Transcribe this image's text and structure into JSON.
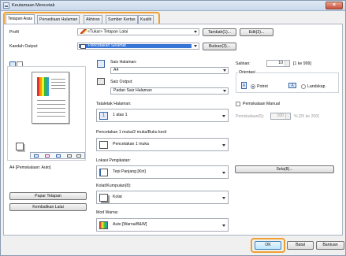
{
  "window": {
    "title": "Keutamaan Mencetak",
    "close_label": "×"
  },
  "tabs": [
    {
      "label": "Tetapan Asas"
    },
    {
      "label": "Persediaan Halaman"
    },
    {
      "label": "Akhiran"
    },
    {
      "label": "Sumber Kertas"
    },
    {
      "label": "Kualiti"
    }
  ],
  "profile": {
    "label": "Profil",
    "value": "<Tukar> Tetapan Lalai",
    "add_button": "Tambah(1)...",
    "edit_button": "Edit(2)..."
  },
  "output": {
    "label": "Kaedah Output:",
    "value": "Pencetakan Selamat",
    "details_button": "Butiran(3)..."
  },
  "preview": {
    "caption": "A4 [Pemskalaan: Auto]",
    "page_layout_button": "Papar Tetapan",
    "restore_defaults_button": "Kembalikan Lalai"
  },
  "page_size": {
    "label": "Saiz Halaman:",
    "value": "A4"
  },
  "output_size": {
    "label": "Saiz Output:",
    "value": "Padan Saiz Halaman"
  },
  "copies": {
    "label": "Salinan:",
    "value": "10",
    "range": "[1 ke 999]"
  },
  "orientation": {
    "label": "Orientasi",
    "portrait": "Potret",
    "landscape": "Landskap",
    "selected": "portrait"
  },
  "manual_scaling": {
    "label": "Pemskalaan Manual",
    "scaling_label": "Pemskalaan(5):",
    "value": "100",
    "range": "% [25 ke 200]",
    "checked": false
  },
  "page_layout": {
    "label": "Tataletak Halaman:",
    "value": "1 atas 1"
  },
  "duplex": {
    "label": "Pencetakan 1 muka/2 muka/Buku kecil",
    "value": "Pencetakan 1 muka"
  },
  "binding": {
    "label": "Lokasi Pengikatan:",
    "value": "Tepi Panjang [Kiri]",
    "gutter_button": "Sela(8)..."
  },
  "collate": {
    "label": "Kolat/Kumpulan(8):",
    "value": "Kolat"
  },
  "color_mode": {
    "label": "Mod Warna:",
    "value": "Auto [Warna/B&W]"
  },
  "footer": {
    "ok": "OK",
    "cancel": "Batal",
    "help": "Bantuan"
  },
  "colors": {
    "accent": "#f0a030",
    "selection": "#3875d7"
  }
}
